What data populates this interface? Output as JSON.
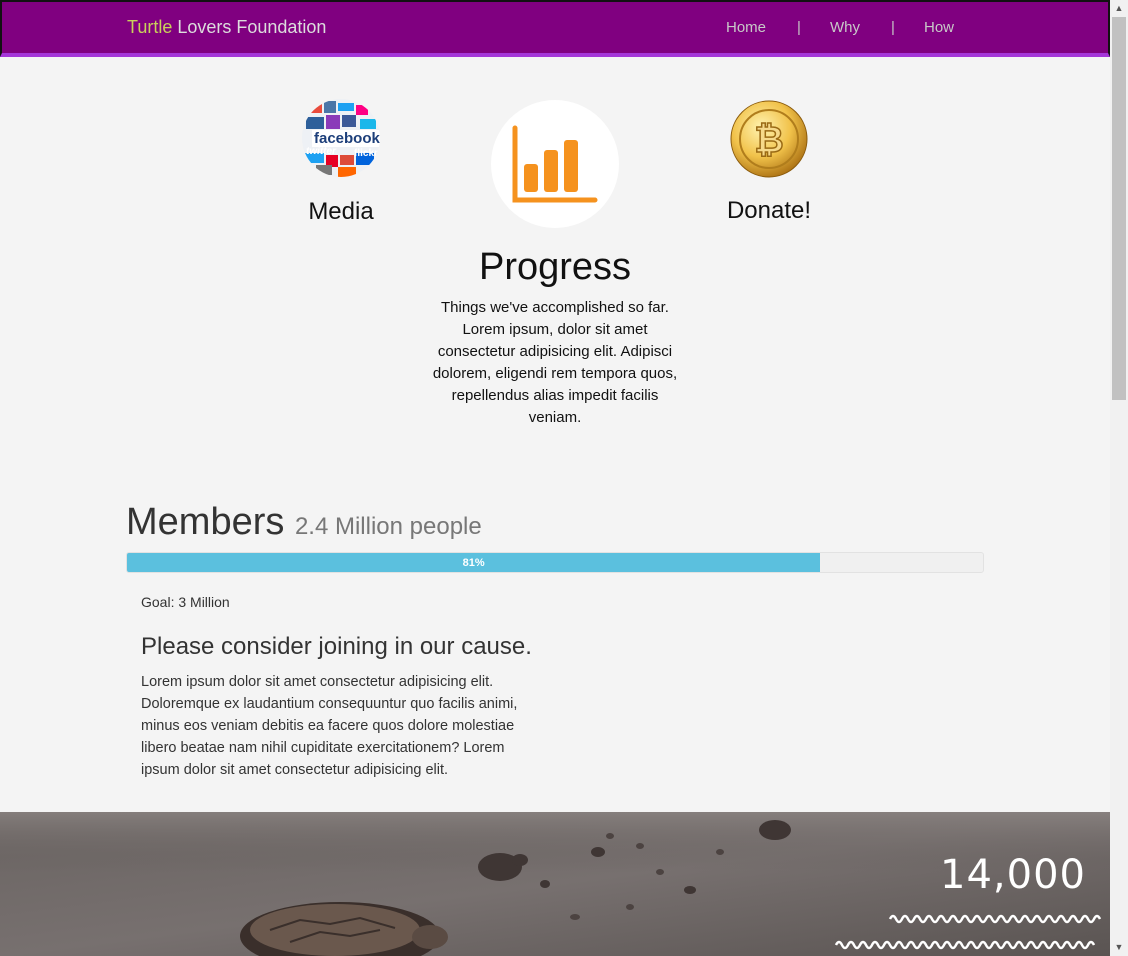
{
  "navbar": {
    "brand_highlight": "Turtle",
    "brand_rest": " Lovers Foundation",
    "links": [
      "Home",
      "Why",
      "How"
    ],
    "separator": "|"
  },
  "features": {
    "media_label": "Media",
    "donate_label": "Donate!",
    "progress_title": "Progress",
    "progress_text": "Things we've accomplished so far. Lorem ipsum, dolor sit amet consectetur adipisicing elit. Adipisci dolorem, eligendi rem tempora quos, repellendus alias impedit facilis veniam.",
    "media_logo_words": [
      "facebook",
      "twitter",
      "flickr",
      "vimeo",
      "square",
      "vk"
    ]
  },
  "members": {
    "title": "Members",
    "subtitle": "2.4 Million people",
    "progress_percent": 81,
    "progress_label": "81%",
    "goal": "Goal: 3 Million",
    "join_title": "Please consider joining in our cause.",
    "join_text": "Lorem ipsum dolor sit amet consectetur adipisicing elit. Doloremque ex laudantium consequuntur quo facilis animi, minus eos veniam debitis ea facere quos dolore molestiae libero beatae nam nihil cupiditate exercitationem? Lorem ipsum dolor sit amet consectetur adipisicing elit."
  },
  "banner": {
    "count": "14,000"
  },
  "colors": {
    "navbar_bg": "#800080",
    "accent": "#5bc0de",
    "chart_icon": "#f5921e"
  },
  "icons": [
    "social-media-collage-icon",
    "bar-chart-icon",
    "bitcoin-coin-icon"
  ]
}
